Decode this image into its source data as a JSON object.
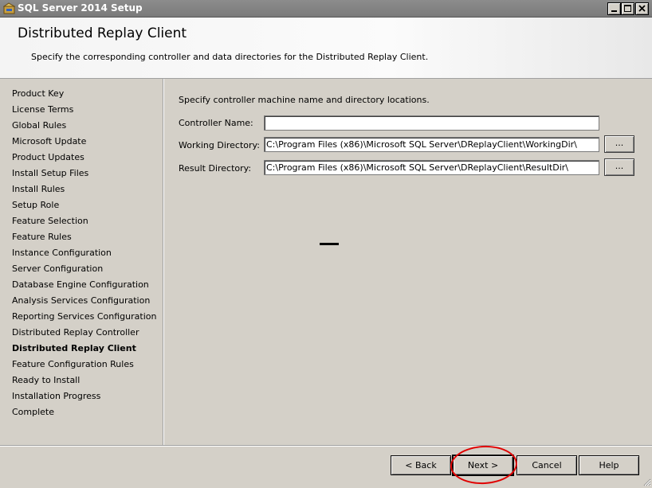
{
  "window": {
    "title": "SQL Server 2014 Setup"
  },
  "header": {
    "title": "Distributed Replay Client",
    "subtitle": "Specify the corresponding controller and data directories for the Distributed Replay Client."
  },
  "nav": {
    "items": [
      {
        "label": "Product Key"
      },
      {
        "label": "License Terms"
      },
      {
        "label": "Global Rules"
      },
      {
        "label": "Microsoft Update"
      },
      {
        "label": "Product Updates"
      },
      {
        "label": "Install Setup Files"
      },
      {
        "label": "Install Rules"
      },
      {
        "label": "Setup Role"
      },
      {
        "label": "Feature Selection"
      },
      {
        "label": "Feature Rules"
      },
      {
        "label": "Instance Configuration"
      },
      {
        "label": "Server Configuration"
      },
      {
        "label": "Database Engine Configuration"
      },
      {
        "label": "Analysis Services Configuration"
      },
      {
        "label": "Reporting Services Configuration"
      },
      {
        "label": "Distributed Replay Controller"
      },
      {
        "label": "Distributed Replay Client",
        "active": true
      },
      {
        "label": "Feature Configuration Rules"
      },
      {
        "label": "Ready to Install"
      },
      {
        "label": "Installation Progress"
      },
      {
        "label": "Complete"
      }
    ]
  },
  "main": {
    "instruction": "Specify controller machine name and directory locations.",
    "controller_label": "Controller Name:",
    "controller_value": "",
    "working_label": "Working Directory:",
    "working_value": "C:\\Program Files (x86)\\Microsoft SQL Server\\DReplayClient\\WorkingDir\\",
    "result_label": "Result Directory:",
    "result_value": "C:\\Program Files (x86)\\Microsoft SQL Server\\DReplayClient\\ResultDir\\",
    "browse_label": "..."
  },
  "footer": {
    "back_label": "< Back",
    "next_label": "Next >",
    "cancel_label": "Cancel",
    "help_label": "Help"
  },
  "colors": {
    "annotation_circle": "#e00000",
    "titlebar": "#808080"
  }
}
